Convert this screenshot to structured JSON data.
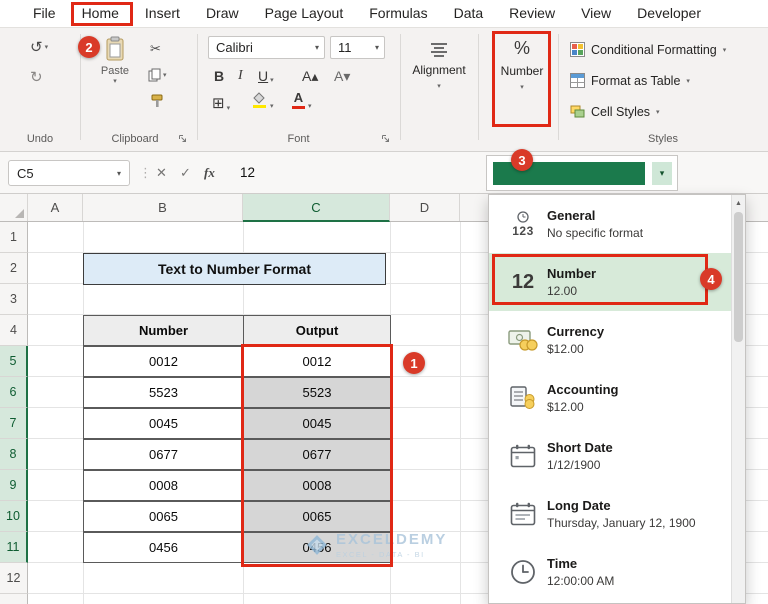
{
  "tabs": [
    {
      "label": "File"
    },
    {
      "label": "Home"
    },
    {
      "label": "Insert"
    },
    {
      "label": "Draw"
    },
    {
      "label": "Page Layout"
    },
    {
      "label": "Formulas"
    },
    {
      "label": "Data"
    },
    {
      "label": "Review"
    },
    {
      "label": "View"
    },
    {
      "label": "Developer"
    }
  ],
  "icons": {
    "undo": "↺",
    "redo": "↻",
    "cut": "✂",
    "chevron_down": "▾",
    "bold": "B",
    "italic": "I",
    "underline": "U",
    "grow_font": "A▴",
    "shrink_font": "A▾",
    "borders": "⊞",
    "font_color_letter": "A",
    "dots": "⋮",
    "scroll_up": "▲",
    "general_123": "123",
    "number_12": "12"
  },
  "ribbon": {
    "undo": {
      "label": "Undo"
    },
    "clipboard": {
      "label": "Clipboard",
      "paste": "Paste"
    },
    "font": {
      "label": "Font",
      "name": "Calibri",
      "size": "11"
    },
    "alignment": {
      "label": "Alignment"
    },
    "number": {
      "label": "Number",
      "percent": "%"
    },
    "styles": {
      "label": "Styles",
      "conditional": "Conditional Formatting",
      "format_table": "Format as Table",
      "cell_styles": "Cell Styles"
    }
  },
  "formula_bar": {
    "name_box": "C5",
    "cancel": "✕",
    "enter": "✓",
    "fx": "fx",
    "value": "12"
  },
  "sheet": {
    "columns": [
      "A",
      "B",
      "C",
      "D"
    ],
    "rows": [
      "1",
      "2",
      "3",
      "4",
      "5",
      "6",
      "7",
      "8",
      "9",
      "10",
      "11",
      "12"
    ],
    "title": "Text to Number Format",
    "table": {
      "headers": [
        "Number",
        "Output"
      ],
      "rows": [
        {
          "number": "0012",
          "output": "0012"
        },
        {
          "number": "5523",
          "output": "5523"
        },
        {
          "number": "0045",
          "output": "0045"
        },
        {
          "number": "0677",
          "output": "0677"
        },
        {
          "number": "0008",
          "output": "0008"
        },
        {
          "number": "0065",
          "output": "0065"
        },
        {
          "number": "0456",
          "output": "0456"
        }
      ]
    }
  },
  "format_dropdown": {
    "items": [
      {
        "label": "General",
        "sample": "No specific format",
        "icon": "general-123-icon"
      },
      {
        "label": "Number",
        "sample": "12.00",
        "icon": "number-12-icon",
        "highlighted": true
      },
      {
        "label": "Currency",
        "sample": "$12.00",
        "icon": "currency-icon"
      },
      {
        "label": "Accounting",
        "sample": "$12.00",
        "icon": "accounting-icon"
      },
      {
        "label": "Short Date",
        "sample": "1/12/1900",
        "icon": "short-date-icon"
      },
      {
        "label": "Long Date",
        "sample": "Thursday, January 12, 1900",
        "icon": "long-date-icon"
      },
      {
        "label": "Time",
        "sample": "12:00:00 AM",
        "icon": "time-icon"
      }
    ]
  },
  "annotations": {
    "step1": "1",
    "step2": "2",
    "step3": "3",
    "step4": "4"
  },
  "watermark": {
    "brand": "EXCELDEMY",
    "tagline": "EXCEL - DATA - BI"
  },
  "colors": {
    "excel_green": "#1e7145",
    "annotation_red": "#e02815",
    "selection_gray": "#d6d6d6",
    "title_fill": "#ddebf7",
    "highlight_green": "#d7ead9"
  }
}
